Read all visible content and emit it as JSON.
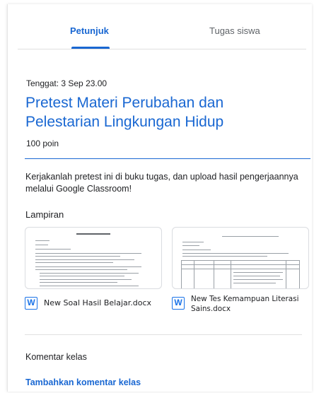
{
  "tabs": [
    {
      "label": "Petunjuk"
    },
    {
      "label": "Tugas siswa"
    }
  ],
  "assignment": {
    "due": "Tenggat: 3 Sep 23.00",
    "title": "Pretest Materi Perubahan dan Pelestarian Lingkungan Hidup",
    "points": "100 poin",
    "instructions": "Kerjakanlah pretest ini di buku tugas, dan upload hasil pengerjaannya melalui Google Classroom!"
  },
  "attachments": {
    "heading": "Lampiran",
    "files": [
      {
        "name": "New Soal Hasil Belajar.docx",
        "icon": "word-doc-icon",
        "icon_letter": "W"
      },
      {
        "name": "New Tes Kemampuan Literasi Sains.docx",
        "icon": "word-doc-icon",
        "icon_letter": "W"
      }
    ]
  },
  "comments": {
    "heading": "Komentar kelas",
    "add_label": "Tambahkan komentar kelas"
  },
  "colors": {
    "accent": "#1967d2",
    "text": "#202124",
    "muted": "#5f6368"
  }
}
